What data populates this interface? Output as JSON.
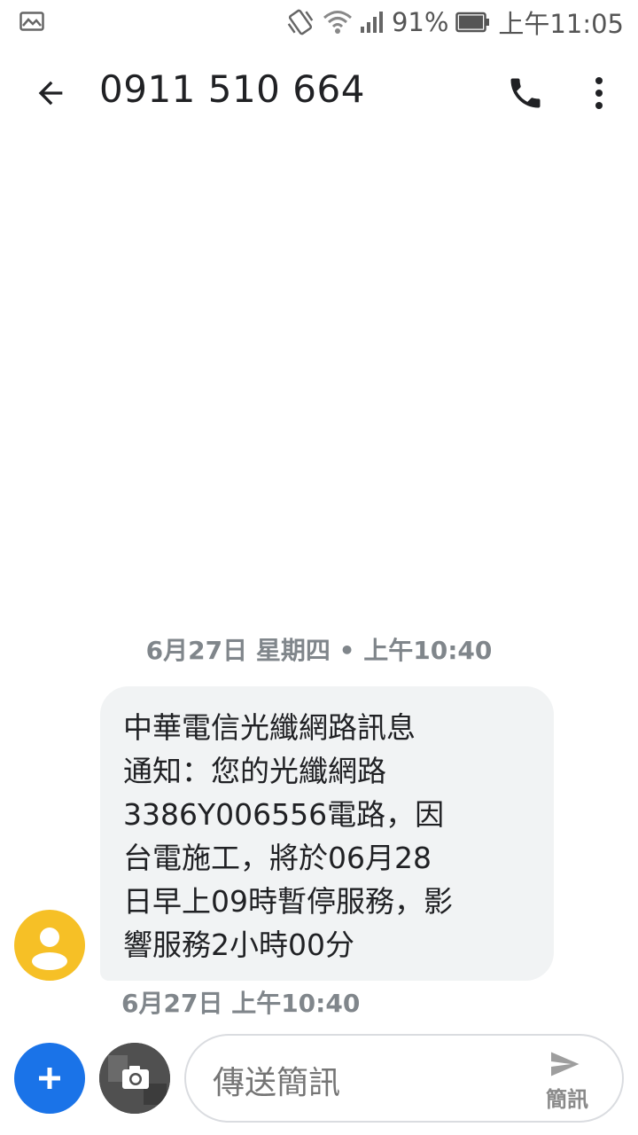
{
  "status_bar": {
    "icons": [
      "gallery-icon",
      "vibrate-icon",
      "wifi-icon",
      "signal-icon",
      "battery-icon"
    ],
    "battery": "91%",
    "clock": "上午11:05"
  },
  "toolbar": {
    "title": "0911 510 664",
    "icons": [
      "back-arrow-icon",
      "phone-icon",
      "more-vertical-icon"
    ]
  },
  "conversation": {
    "date_divider": "6月27日 星期四 • 上午10:40",
    "messages": [
      {
        "direction": "incoming",
        "text": "中華電信光纖網路訊息\n通知：您的光纖網路\n3386Y006556電路，因\n台電施工，將於06月28\n日早上09時暫停服務，影\n響服務2小時00分",
        "time": "6月27日 上午10:40"
      }
    ]
  },
  "compose": {
    "placeholder": "傳送簡訊",
    "send_label": "簡訊",
    "icons": [
      "plus-icon",
      "camera-icon",
      "send-icon"
    ]
  },
  "colors": {
    "accent": "#1a73e8",
    "avatar": "#f6c026",
    "bubble": "#f1f3f4",
    "secondary_text": "#80868b"
  }
}
